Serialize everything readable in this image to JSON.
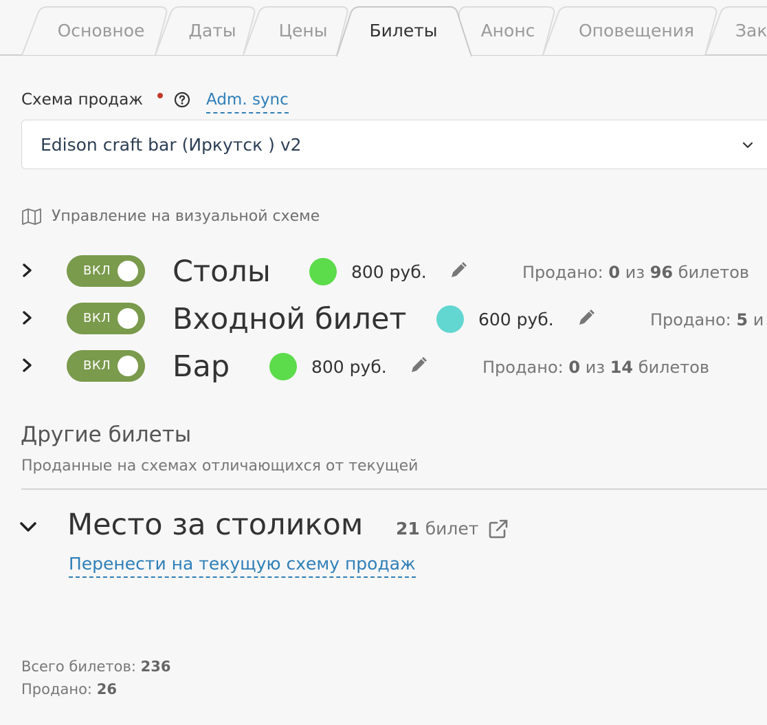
{
  "tabs": [
    {
      "label": "Основное",
      "active": false
    },
    {
      "label": "Даты",
      "active": false
    },
    {
      "label": "Цены",
      "active": false
    },
    {
      "label": "Билеты",
      "active": true
    },
    {
      "label": "Анонс",
      "active": false
    },
    {
      "label": "Оповещения",
      "active": false
    },
    {
      "label": "Зак",
      "active": false
    }
  ],
  "scheme": {
    "label": "Схема продаж",
    "adm_link": "Adm. sync",
    "selected": "Edison craft bar (Иркутск ) v2"
  },
  "visual_control": "Управление на визуальной схеме",
  "price_rows": [
    {
      "toggle": "ВКЛ",
      "title": "Столы",
      "dot_color": "#5cdb4b",
      "price": "800 руб.",
      "sold_prefix": "Продано:",
      "sold": "0",
      "sold_mid": "из",
      "total": "96",
      "sold_suffix": "билетов"
    },
    {
      "toggle": "ВКЛ",
      "title": "Входной билет",
      "dot_color": "#62d6d0",
      "price": "600 руб.",
      "sold_prefix": "Продано:",
      "sold": "5",
      "sold_mid": "и",
      "total": "",
      "sold_suffix": ""
    },
    {
      "toggle": "ВКЛ",
      "title": "Бар",
      "dot_color": "#5cdb4b",
      "price": "800 руб.",
      "sold_prefix": "Продано:",
      "sold": "0",
      "sold_mid": "из",
      "total": "14",
      "sold_suffix": "билетов"
    }
  ],
  "other": {
    "title": "Другие билеты",
    "subtitle": "Проданные на схемах отличающихся от текущей",
    "item_title": "Место за столиком",
    "item_count": "21",
    "item_count_label": "билет",
    "move_link": "Перенести на текущую схему продаж"
  },
  "totals": {
    "total_label": "Всего билетов:",
    "total": "236",
    "sold_label": "Продано:",
    "sold": "26"
  },
  "colors": {
    "accent_link": "#2f7fb8",
    "toggle_on": "#7a9a4c",
    "required": "#c0392b"
  }
}
